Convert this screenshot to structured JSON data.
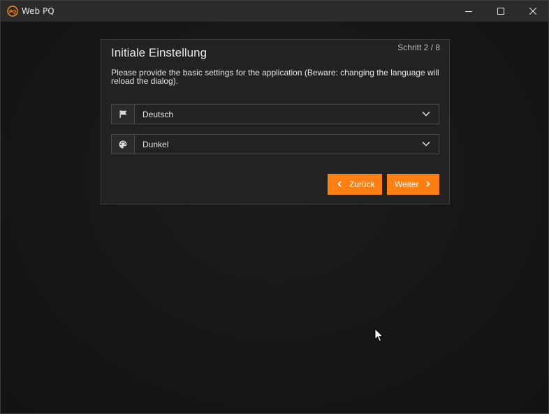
{
  "window": {
    "title": "Web PQ",
    "app_icon_text": "PQ",
    "controls": {
      "minimize": "minimize-icon",
      "maximize": "maximize-icon",
      "close": "close-icon"
    }
  },
  "wizard": {
    "title": "Initiale Einstellung",
    "step": "Schritt 2 / 8",
    "description": "Please provide the basic settings for the application (Beware: changing the language will reload the dialog).",
    "language": {
      "icon": "flag-icon",
      "value": "Deutsch"
    },
    "theme": {
      "icon": "palette-icon",
      "value": "Dunkel"
    },
    "back_label": "Zurück",
    "next_label": "Weiter"
  },
  "colors": {
    "accent": "#ff7f11",
    "panel": "#222222",
    "titlebar": "#2b2b2b"
  }
}
